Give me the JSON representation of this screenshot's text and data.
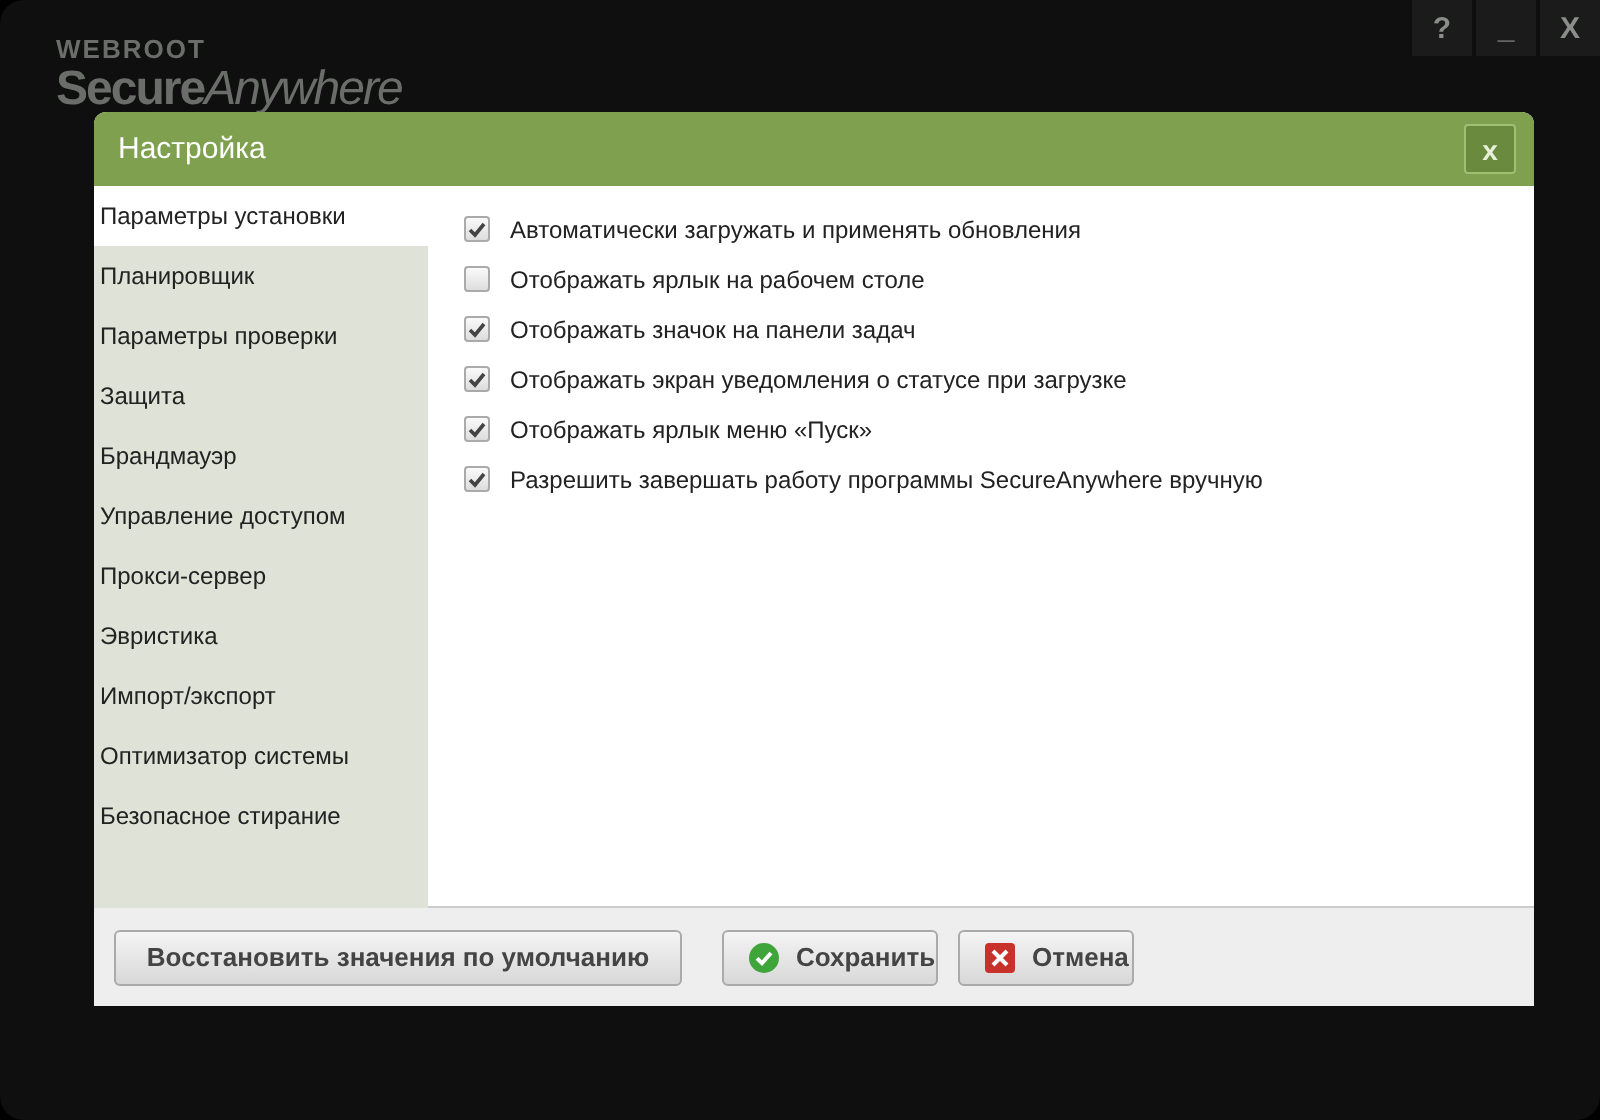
{
  "app": {
    "brand": "WEBROOT",
    "product_bold": "Secure",
    "product_light": "Anywhere",
    "window_buttons": [
      "?",
      "_",
      "X"
    ]
  },
  "dialog": {
    "title": "Настройка",
    "close": "x"
  },
  "sidebar": {
    "items": [
      {
        "label": "Параметры установки",
        "selected": true
      },
      {
        "label": "Планировщик",
        "selected": false
      },
      {
        "label": "Параметры проверки",
        "selected": false
      },
      {
        "label": "Защита",
        "selected": false
      },
      {
        "label": "Брандмауэр",
        "selected": false
      },
      {
        "label": "Управление доступом",
        "selected": false
      },
      {
        "label": "Прокси-сервер",
        "selected": false
      },
      {
        "label": "Эвристика",
        "selected": false
      },
      {
        "label": "Импорт/экспорт",
        "selected": false
      },
      {
        "label": "Оптимизатор системы",
        "selected": false
      },
      {
        "label": "Безопасное стирание",
        "selected": false
      }
    ]
  },
  "options": [
    {
      "label": "Автоматически загружать и применять обновления",
      "checked": true
    },
    {
      "label": "Отображать ярлык на рабочем столе",
      "checked": false
    },
    {
      "label": "Отображать значок на панели задач",
      "checked": true
    },
    {
      "label": "Отображать экран уведомления о статусе при загрузке",
      "checked": true
    },
    {
      "label": "Отображать ярлык меню «Пуск»",
      "checked": true
    },
    {
      "label": "Разрешить завершать работу программы SecureAnywhere вручную",
      "checked": true
    }
  ],
  "buttons": [
    {
      "label": "Восстановить значения по умолчанию",
      "kind": "plain"
    },
    {
      "label": "Сохранить",
      "kind": "save"
    },
    {
      "label": "Отмена",
      "kind": "cancel"
    }
  ]
}
